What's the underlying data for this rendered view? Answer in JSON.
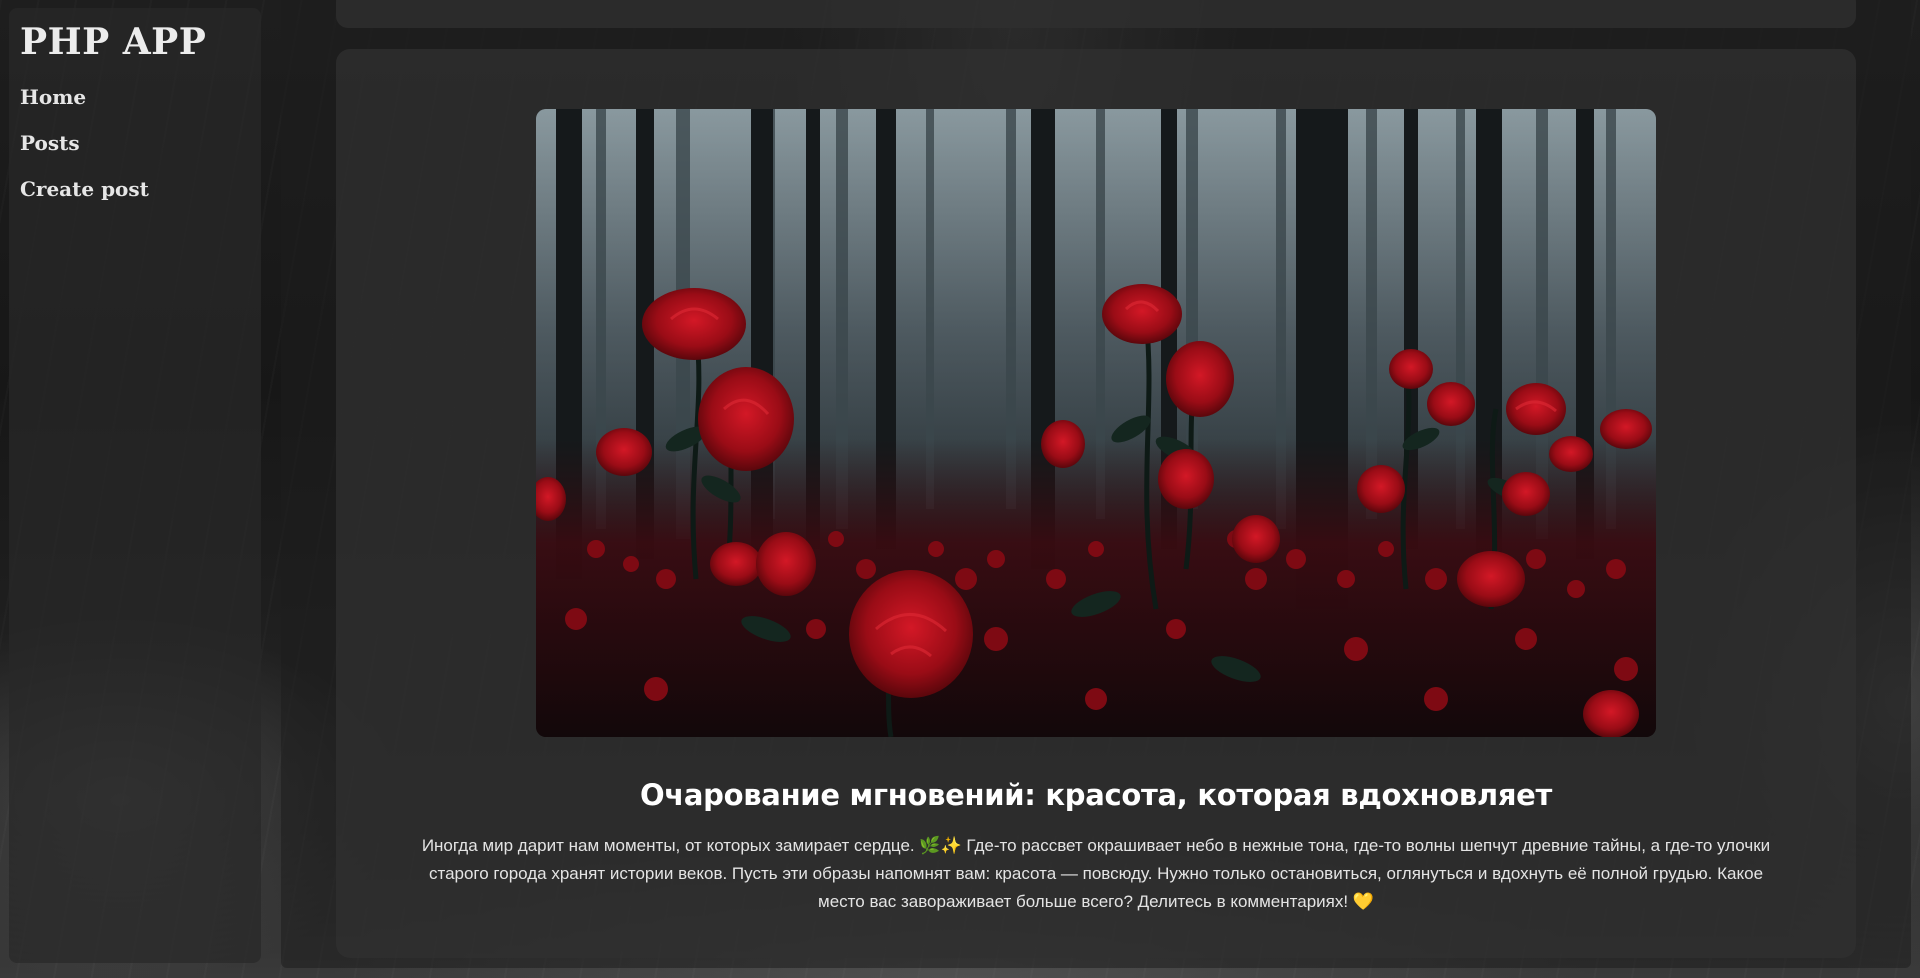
{
  "sidebar": {
    "brand": "PHP APP",
    "items": [
      {
        "label": "Home"
      },
      {
        "label": "Posts"
      },
      {
        "label": "Create post"
      }
    ]
  },
  "post": {
    "image_icon": "rose-forest-image",
    "title": "Очарование мгновений: красота, которая вдохновляет",
    "body": "Иногда мир дарит нам моменты, от которых замирает сердце. 🌿✨ Где-то рассвет окрашивает небо в нежные тона, где-то волны шепчут древние тайны, а где-то улочки старого города хранят истории веков. Пусть эти образы напомнят вам: красота — повсюду. Нужно только остановиться, оглянуться и вдохнуть её полной грудью. Какое место вас завораживает больше всего? Делитесь в комментариях! 💛"
  },
  "colors": {
    "background": "#141414",
    "panel": "#2e2e2e",
    "rose": "#a3101a"
  }
}
